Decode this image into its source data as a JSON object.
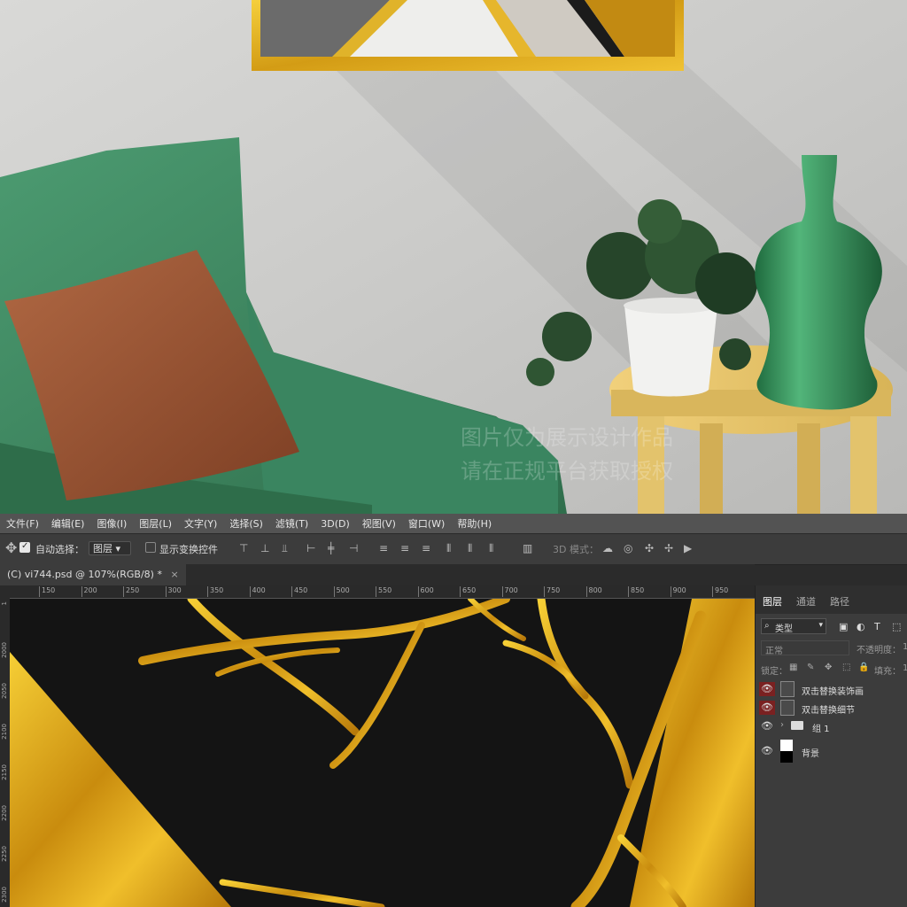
{
  "watermark": {
    "line1": "图片仅为展示设计作品",
    "line2": "请在正规平台获取授权"
  },
  "menu": [
    "文件(F)",
    "编辑(E)",
    "图像(I)",
    "图层(L)",
    "文字(Y)",
    "选择(S)",
    "滤镜(T)",
    "3D(D)",
    "视图(V)",
    "窗口(W)",
    "帮助(H)"
  ],
  "options": {
    "auto_select_label": "自动选择：",
    "auto_select_value": "图层",
    "show_transform_label": "显示变换控件",
    "mode_3d_label": "3D 模式："
  },
  "document": {
    "tab_title": "(C) vi744.psd @ 107%(RGB/8) *",
    "close": "×"
  },
  "ruler": {
    "top": [
      "150",
      "200",
      "250",
      "300",
      "350",
      "400",
      "450",
      "500",
      "550",
      "600",
      "650",
      "700",
      "750",
      "800",
      "850",
      "900",
      "950"
    ],
    "left": [
      "1",
      "2000",
      "2050",
      "2100",
      "2150",
      "2200",
      "2250",
      "2300"
    ]
  },
  "panel": {
    "tabs": [
      "图层",
      "通道",
      "路径"
    ],
    "filter": "类型",
    "blend_mode": "正常",
    "opacity_label": "不透明度：",
    "opacity_value": "1",
    "lock_label": "锁定：",
    "fill_label": "填充：",
    "fill_value": "1",
    "layers": [
      {
        "name": "双击替换装饰画",
        "kind": "smart",
        "eye": "red"
      },
      {
        "name": "双击替换细节",
        "kind": "smart",
        "eye": "red"
      },
      {
        "name": "组 1",
        "kind": "group",
        "eye": "normal"
      },
      {
        "name": "背景",
        "kind": "background",
        "eye": "normal"
      }
    ]
  },
  "colors": {
    "gold": "#d9a419",
    "sofa": "#3f8a62",
    "pillow": "#9a5434",
    "table": "#e8c56a",
    "vase": "#2f8d55"
  }
}
